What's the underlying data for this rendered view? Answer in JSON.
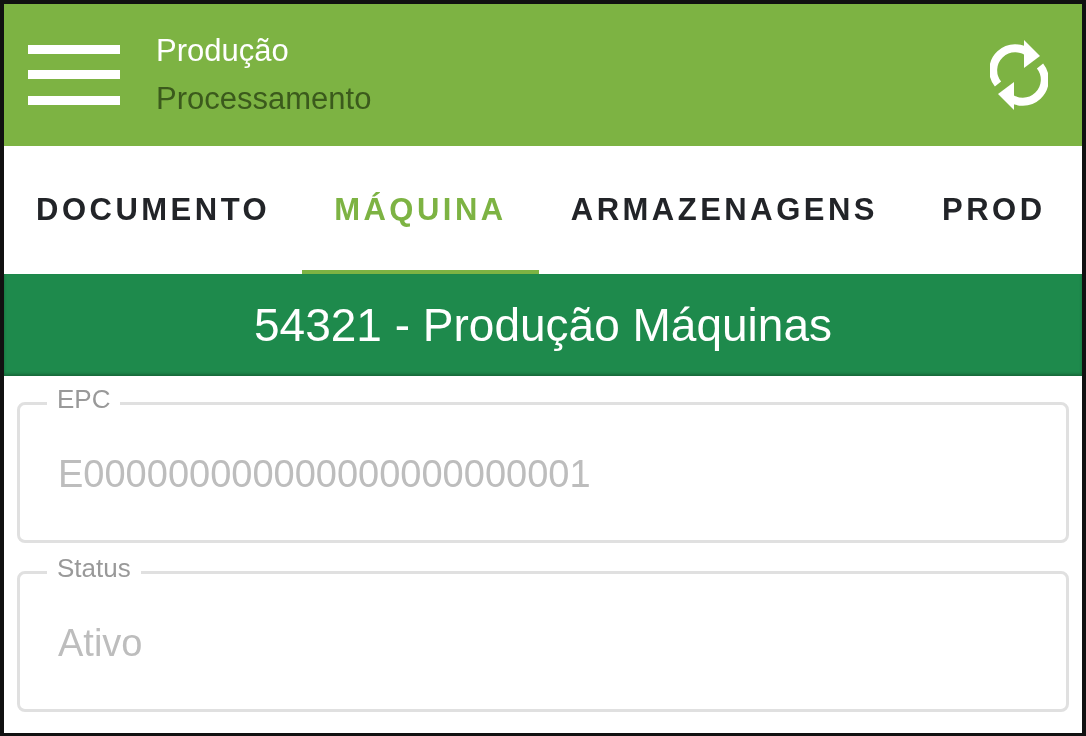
{
  "app_bar": {
    "title": "Produção",
    "subtitle": "Processamento"
  },
  "tabs": [
    {
      "label": "DOCUMENTO",
      "selected": false
    },
    {
      "label": "MÁQUINA",
      "selected": true
    },
    {
      "label": "ARMAZENAGENS",
      "selected": false
    },
    {
      "label": "PROD",
      "selected": false
    }
  ],
  "banner": {
    "text": "54321 - Produção Máquinas"
  },
  "fields": [
    {
      "label": "EPC",
      "value": "E000000000000000000000001",
      "disabled": true
    },
    {
      "label": "Status",
      "value": "Ativo",
      "disabled": true
    }
  ]
}
